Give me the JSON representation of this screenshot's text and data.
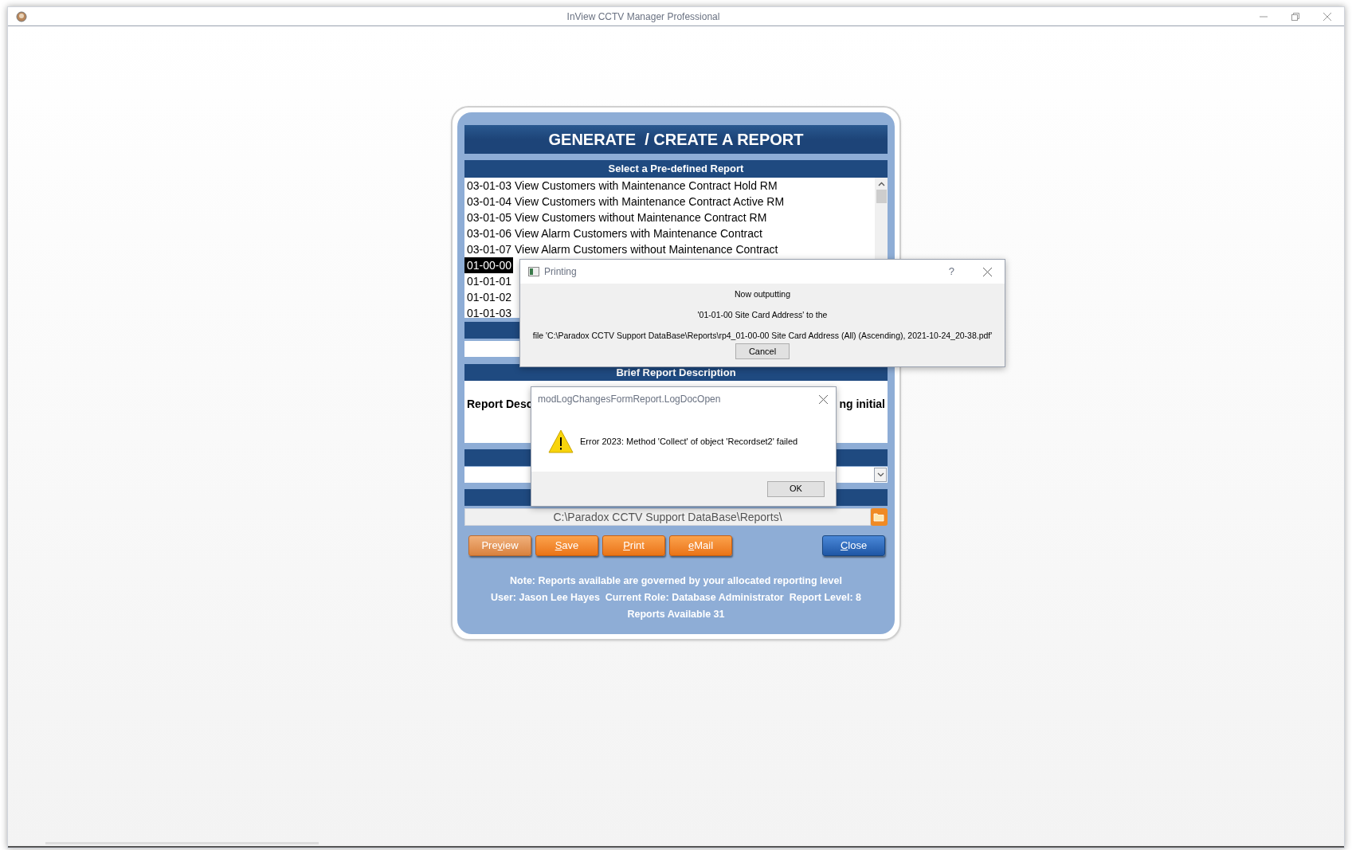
{
  "window": {
    "title": "InView CCTV Manager Professional"
  },
  "form": {
    "title": "GENERATE  / CREATE A REPORT",
    "report_list": {
      "heading": "Select a Pre-defined Report",
      "items": [
        {
          "label": "03-01-03 View Customers with Maintenance Contract Hold RM",
          "selected": false
        },
        {
          "label": "03-01-04 View Customers with Maintenance Contract Active RM",
          "selected": false
        },
        {
          "label": "03-01-05 View Customers without Maintenance Contract RM",
          "selected": false
        },
        {
          "label": "03-01-06 View Alarm Customers with Maintenance Contract",
          "selected": false
        },
        {
          "label": "03-01-07 View Alarm Customers without Maintenance Contract",
          "selected": false
        },
        {
          "label": "01-00-00",
          "selected": true
        },
        {
          "label": "01-01-01",
          "selected": false
        },
        {
          "label": "01-01-02",
          "selected": false
        },
        {
          "label": "01-01-03",
          "selected": false
        }
      ]
    },
    "description": {
      "heading": "Brief Report Description",
      "text_left": "Report Desc",
      "text_right": "ng initial"
    },
    "output_folder": {
      "value": "C:\\Paradox CCTV Support DataBase\\Reports\\"
    },
    "buttons": [
      {
        "kind": "action",
        "before": "Pre",
        "key": "v",
        "after": "iew",
        "hover": true
      },
      {
        "kind": "action",
        "key": "S",
        "after": "ave",
        "hover": false
      },
      {
        "kind": "action",
        "key": "P",
        "after": "rint",
        "hover": false
      },
      {
        "kind": "action",
        "key": "e",
        "after": "Mail",
        "hover": false
      },
      {
        "kind": "close",
        "key": "C",
        "after": "lose",
        "hover": false
      }
    ],
    "notes": [
      "Note: Reports available are governed by your allocated reporting level",
      "User: Jason Lee Hayes  Current Role: Database Administrator  Report Level: 8",
      "Reports Available 31"
    ]
  },
  "printing_dialog": {
    "title": "Printing",
    "help": "?",
    "lines": [
      "Now outputting",
      "'01-01-00 Site Card Address' to the",
      "file 'C:\\Paradox CCTV Support DataBase\\Reports\\rp4_01-00-00 Site Card Address (All) (Ascending), 2021-10-24_20-38.pdf'"
    ],
    "cancel": "Cancel"
  },
  "error_dialog": {
    "title": "modLogChangesFormReport.LogDocOpen",
    "message": "Error 2023: Method 'Collect' of object 'Recordset2' failed",
    "ok": "OK"
  }
}
